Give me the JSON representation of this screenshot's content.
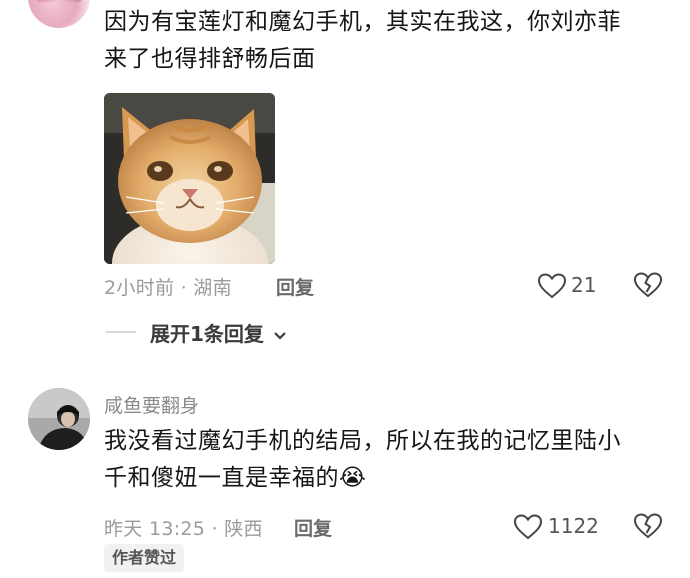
{
  "comments": [
    {
      "text_line1": "因为有宝莲灯和魔幻手机，其实在我这，你刘亦菲",
      "text_line2": "来了也得排舒畅后面",
      "time": "2小时前 · 湖南",
      "reply_label": "回复",
      "likes": "21",
      "expand_label": "展开1条回复"
    },
    {
      "username": "咸鱼要翻身",
      "text_line1": "我没看过魔幻手机的结局，所以在我的记忆里陆小",
      "text_line2": "千和傻妞一直是幸福的",
      "emoji": "😭",
      "time": "昨天 13:25 · 陕西",
      "reply_label": "回复",
      "likes": "1122",
      "badge": "作者赞过"
    }
  ],
  "icons": {
    "like": "heart-outline-icon",
    "dislike": "broken-heart-icon",
    "expand": "chevron-down-icon"
  }
}
